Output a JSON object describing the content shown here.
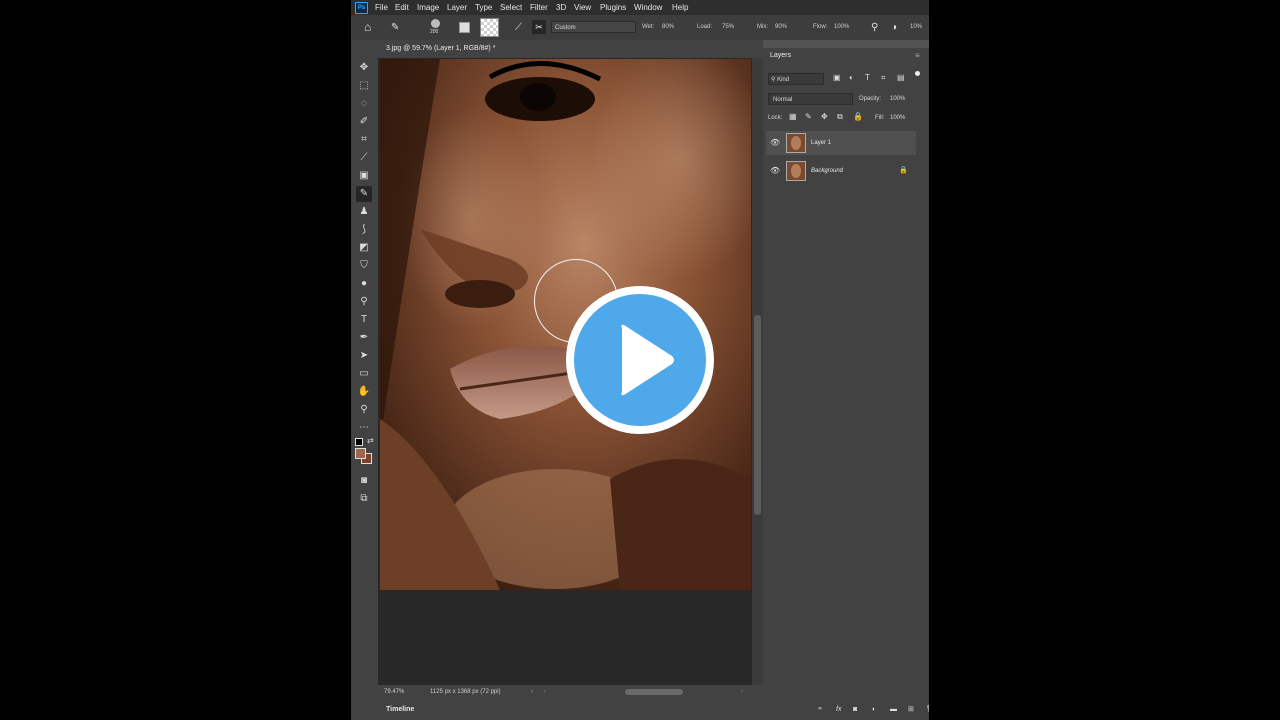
{
  "app": {
    "logo": "Ps",
    "menu": [
      "File",
      "Edit",
      "Image",
      "Layer",
      "Type",
      "Select",
      "Filter",
      "3D",
      "View",
      "Plugins",
      "Window",
      "Help"
    ]
  },
  "options": {
    "brush_size": "200",
    "preset": "Custom",
    "wet_label": "Wet:",
    "wet_value": "80%",
    "load_label": "Load:",
    "load_value": "75%",
    "mix_label": "Mix:",
    "mix_value": "90%",
    "flow_label": "Flow:",
    "flow_value": "100%",
    "smoothing_value": "10%"
  },
  "document": {
    "tab_title": "3.jpg @ 59.7% (Layer 1, RGB/8#) *",
    "zoom": "79.47%",
    "dimensions": "1125 px x 1368 px (72 ppi)"
  },
  "colors": {
    "foreground": "#9c6650",
    "background": "#7a4330",
    "accent_play": "#4ea8ea"
  },
  "layers_panel": {
    "title": "Layers",
    "kind_label": "Kind",
    "blend_mode": "Normal",
    "opacity_label": "Opacity:",
    "opacity_value": "100%",
    "lock_label": "Lock:",
    "fill_label": "Fill:",
    "fill_value": "100%",
    "layers": [
      {
        "name": "Layer 1",
        "selected": true,
        "locked": false
      },
      {
        "name": "Background",
        "selected": false,
        "locked": true
      }
    ]
  },
  "timeline": {
    "label": "Timeline"
  }
}
